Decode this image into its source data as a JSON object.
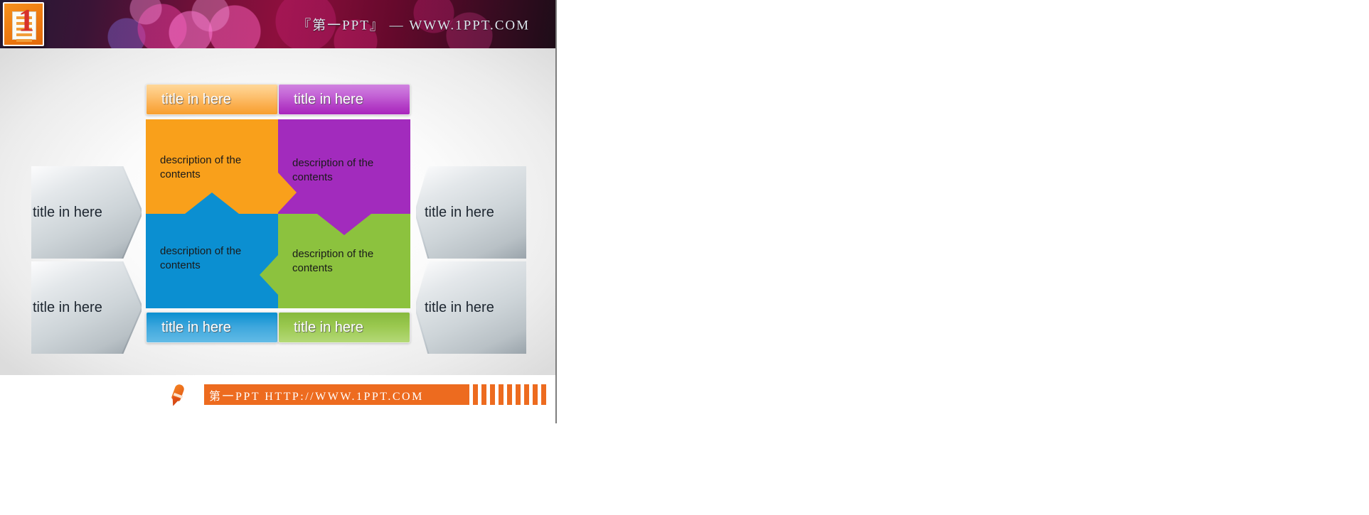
{
  "header": {
    "brand_text": "『第一PPT』 — WWW.1PPT.COM",
    "logo_digit": "1",
    "logo_alt": "first-ppt-logo"
  },
  "diagram": {
    "type": "quadrant-cycle",
    "quadrants": [
      {
        "id": "top-left",
        "title": "title in here",
        "body": "description of the contents",
        "color": "#f9a01b"
      },
      {
        "id": "top-right",
        "title": "title in here",
        "body": "description of the contents",
        "color": "#a22bbd"
      },
      {
        "id": "bottom-left",
        "title": "title in here",
        "body": "description of the contents",
        "color": "#0b8fd1"
      },
      {
        "id": "bottom-right",
        "title": "title in here",
        "body": "description of the contents",
        "color": "#8cc23e"
      }
    ],
    "side_callouts": [
      {
        "id": "left-top",
        "label": "title in here"
      },
      {
        "id": "left-bottom",
        "label": "title in here"
      },
      {
        "id": "right-top",
        "label": "title in here"
      },
      {
        "id": "right-bottom",
        "label": "title in here"
      }
    ],
    "arrows": [
      {
        "from": "top-left",
        "to": "top-right",
        "direction": "right",
        "color": "#f9a01b"
      },
      {
        "from": "top-right",
        "to": "bottom-right",
        "direction": "down",
        "color": "#a22bbd"
      },
      {
        "from": "bottom-right",
        "to": "bottom-left",
        "direction": "left",
        "color": "#8cc23e"
      },
      {
        "from": "bottom-left",
        "to": "top-left",
        "direction": "up",
        "color": "#0b8fd1"
      }
    ]
  },
  "footer": {
    "text": "第一PPT HTTP://WWW.1PPT.COM",
    "accent_color": "#ed6b1f"
  }
}
